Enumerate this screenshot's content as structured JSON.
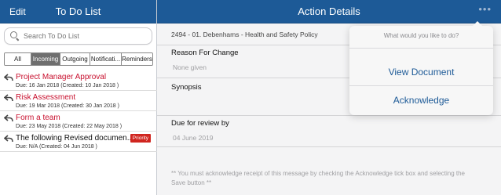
{
  "left_header": {
    "edit_label": "Edit",
    "title": "To Do List"
  },
  "right_header": {
    "title": "Action Details",
    "more_glyph": "•••"
  },
  "search": {
    "placeholder": "Search To Do List"
  },
  "filters": [
    {
      "label": "All",
      "active": false
    },
    {
      "label": "Incoming",
      "active": true
    },
    {
      "label": "Outgoing",
      "active": false
    },
    {
      "label": "Notificati...",
      "active": false
    },
    {
      "label": "Reminders",
      "active": false
    }
  ],
  "todo_items": [
    {
      "title": "Project Manager Approval",
      "meta": "Due: 16 Jan 2018 (Created: 10 Jan 2018 )",
      "color": "red",
      "badge": ""
    },
    {
      "title": "Risk Assessment",
      "meta": "Due: 19 Mar 2018 (Created: 30 Jan 2018 )",
      "color": "red",
      "badge": ""
    },
    {
      "title": "Form a team",
      "meta": "Due: 23 May 2018 (Created: 22 May 2018 )",
      "color": "red",
      "badge": ""
    },
    {
      "title": "The following Revised documen...",
      "meta": "Due: N/A (Created: 04 Jun 2018 )",
      "color": "black",
      "badge": "Priority"
    }
  ],
  "detail": {
    "reference": "2494 - 01. Debenhams - Health and Safety Policy",
    "reason_label": "Reason For Change",
    "reason_value": "None given",
    "synopsis_label": "Synopsis",
    "due_label": "Due for review by",
    "due_value": "04 June 2019",
    "note": "** You must acknowledge receipt of this message by checking the Acknowledge tick box and selecting the Save button **"
  },
  "popover": {
    "title": "What would you like to do?",
    "actions": [
      "View Document",
      "Acknowledge"
    ]
  },
  "colors": {
    "header": "#1d5a97",
    "overdue": "#c8102e",
    "priority": "#d0251f",
    "link": "#1d5a97"
  }
}
